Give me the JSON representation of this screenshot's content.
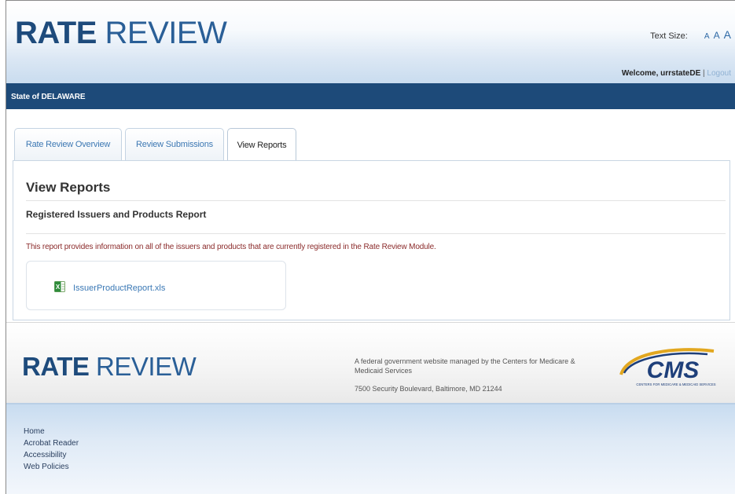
{
  "header": {
    "logo_rate": "RATE",
    "logo_review": " REVIEW",
    "text_size_label": "Text Size:",
    "text_size_options": [
      "A",
      "A",
      "A"
    ],
    "welcome_text": "Welcome, urrstateDE",
    "separator": " | ",
    "logout_label": "Logout"
  },
  "state_bar": {
    "label": "State of DELAWARE"
  },
  "tabs": [
    {
      "label": "Rate Review Overview",
      "active": false
    },
    {
      "label": "Review Submissions",
      "active": false
    },
    {
      "label": "View Reports",
      "active": true
    }
  ],
  "main": {
    "title": "View Reports",
    "subtitle": "Registered Issuers and Products Report",
    "description": "This report provides information on all of the issuers and products that are currently registered in the Rate Review Module.",
    "file": {
      "name": "IssuerProductReport.xls",
      "icon": "excel-file-icon"
    }
  },
  "footer": {
    "logo_rate": "RATE",
    "logo_review": " REVIEW",
    "federal_text": "A federal government website managed by the Centers for Medicare & Medicaid Services",
    "address": "7500 Security Boulevard, Baltimore, MD 21244",
    "cms_logo_text": "CMS",
    "cms_logo_subtext": "CENTERS FOR MEDICARE & MEDICAID SERVICES",
    "links": [
      "Home",
      "Acrobat Reader",
      "Accessibility",
      "Web Policies"
    ]
  },
  "colors": {
    "brand_dark": "#1e4b7c",
    "state_bar": "#1d4a79",
    "link": "#3a78b5",
    "description_text": "#8b2b2b",
    "cms_gold": "#e2a71f"
  }
}
